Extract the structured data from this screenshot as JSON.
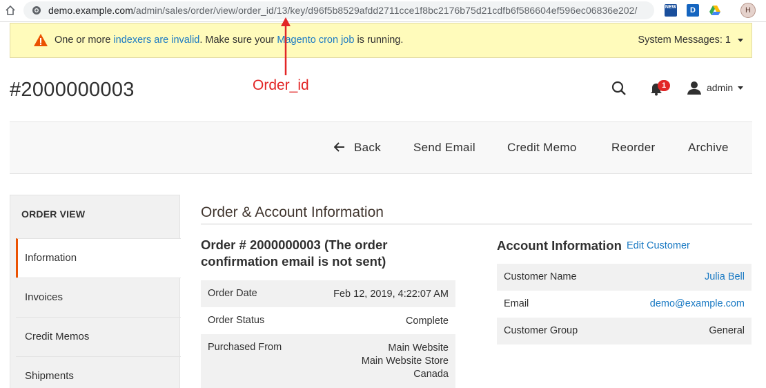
{
  "browser": {
    "url_host": "demo.example.com",
    "url_path": "/admin/sales/order/view/order_id/13/key/d96f5b8529afdd2711cce1f8bc2176b75d21cdfb6f586604ef596ec06836e202/",
    "extensions": [
      "news-extension-icon",
      "d-extension-icon",
      "google-drive-icon"
    ],
    "ext_news_label": "NEW",
    "ext_d_label": "D",
    "profile_initial": "H"
  },
  "system_message": {
    "prefix": "One or more ",
    "link1": "indexers are invalid",
    "middle": ". Make sure your ",
    "link2": "Magento cron job",
    "suffix": " is running.",
    "count_label": "System Messages: 1"
  },
  "annotation": {
    "label": "Order_id",
    "color": "#e22626"
  },
  "header": {
    "title": "#2000000003",
    "notification_count": "1",
    "user": "admin"
  },
  "actions": {
    "back": "Back",
    "send_email": "Send Email",
    "credit_memo": "Credit Memo",
    "reorder": "Reorder",
    "archive": "Archive"
  },
  "nav": {
    "title": "ORDER VIEW",
    "items": [
      {
        "label": "Information",
        "active": true
      },
      {
        "label": "Invoices"
      },
      {
        "label": "Credit Memos"
      },
      {
        "label": "Shipments"
      }
    ]
  },
  "order_info": {
    "section_title": "Order & Account Information",
    "order_heading": "Order # 2000000003 (The order confirmation email is not sent)",
    "rows": [
      {
        "label": "Order Date",
        "value": "Feb 12, 2019, 4:22:07 AM"
      },
      {
        "label": "Order Status",
        "value": "Complete"
      },
      {
        "label": "Purchased From",
        "value_lines": [
          "Main Website",
          "Main Website Store",
          "Canada"
        ]
      }
    ]
  },
  "account_info": {
    "heading": "Account Information",
    "edit_link": "Edit Customer",
    "rows": [
      {
        "label": "Customer Name",
        "value": "Julia Bell"
      },
      {
        "label": "Email",
        "value": "demo@example.com"
      },
      {
        "label": "Customer Group",
        "value": "General"
      }
    ]
  },
  "colors": {
    "link": "#1979c3",
    "accent": "#eb5202",
    "warning_bg": "#fffbbb",
    "badge": "#e22626"
  }
}
